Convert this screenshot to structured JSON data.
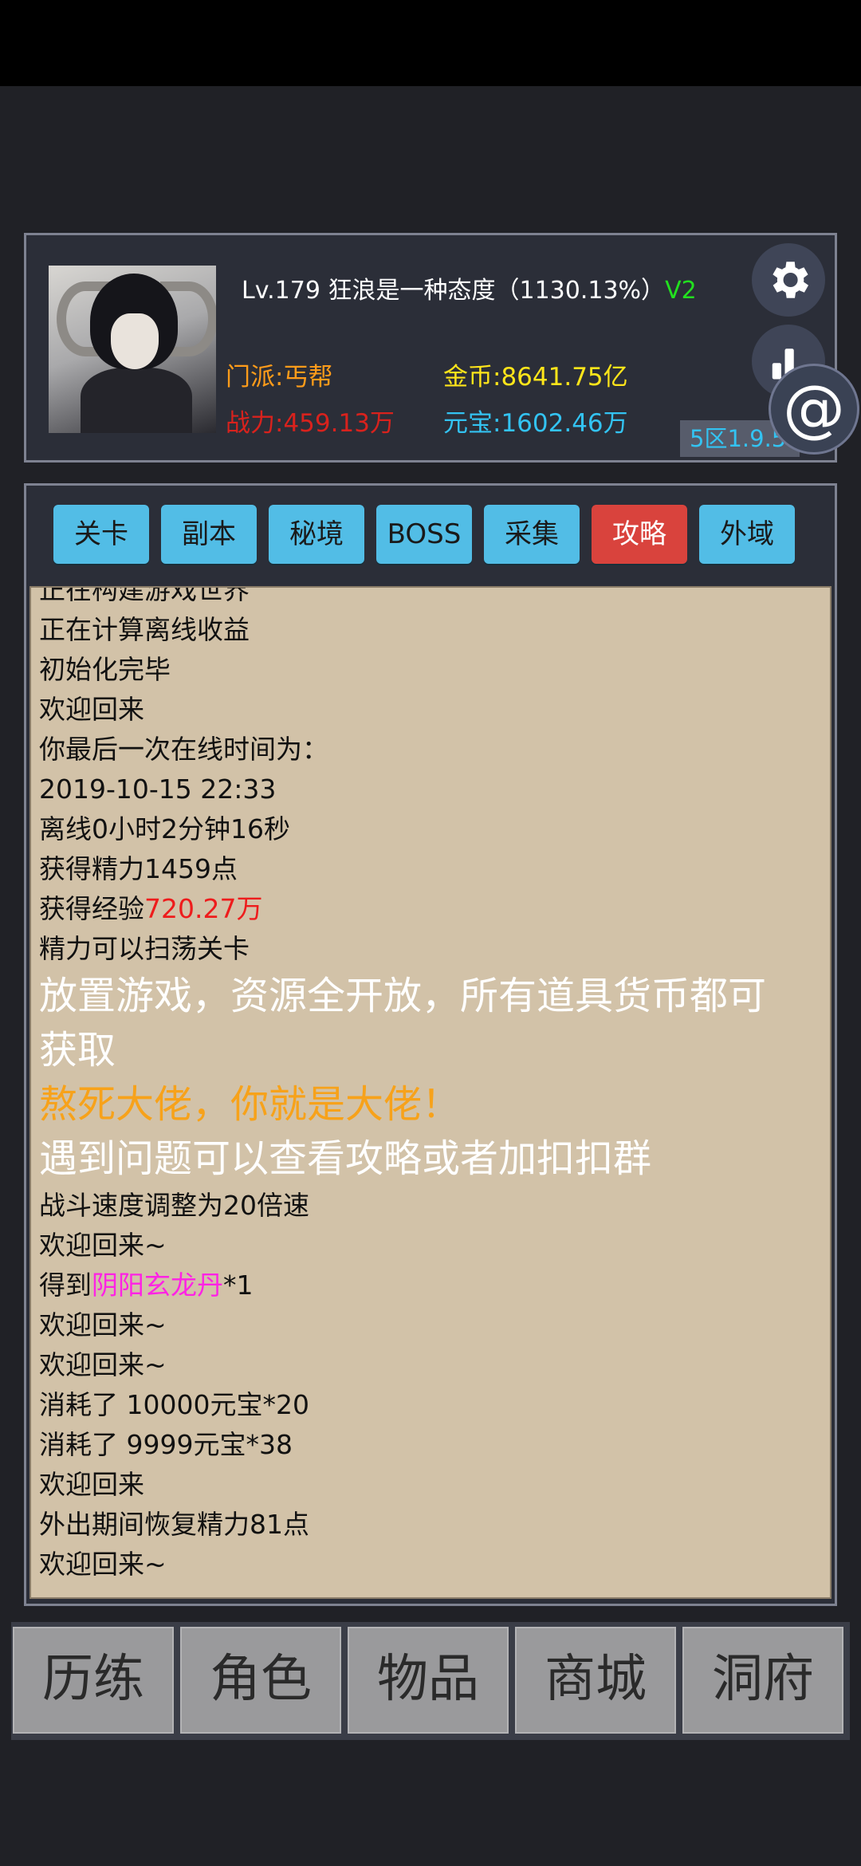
{
  "player": {
    "level": "Lv.179",
    "name": "狂浪是一种态度",
    "exp_percent": "（1130.13%）",
    "vip": "V2",
    "sect": "门派:丐帮",
    "power": "战力:459.13万",
    "gold": "金币:8641.75亿",
    "ingot": "元宝:1602.46万",
    "server": "5区1.9.5"
  },
  "icons": {
    "settings": "gear-icon",
    "ranking": "bar-chart-icon",
    "chat": "at-sign-icon"
  },
  "tabs": [
    {
      "label": "关卡",
      "active": false
    },
    {
      "label": "副本",
      "active": false
    },
    {
      "label": "秘境",
      "active": false
    },
    {
      "label": "BOSS",
      "active": false
    },
    {
      "label": "采集",
      "active": false
    },
    {
      "label": "攻略",
      "active": true
    },
    {
      "label": "外域",
      "active": false
    }
  ],
  "log": {
    "l0": "正在构建游戏世界",
    "l1": "正在计算离线收益",
    "l2": "初始化完毕",
    "l3": "欢迎回来",
    "l4": "你最后一次在线时间为：",
    "l5": "2019-10-15 22:33",
    "l6": "离线0小时2分钟16秒",
    "l7": "获得精力1459点",
    "l8_prefix": "获得经验",
    "l8_value": "720.27万",
    "l9": "精力可以扫荡关卡",
    "notice1": "放置游戏，资源全开放，所有道具货币都可",
    "notice1b": "获取",
    "notice2": "熬死大佬，你就是大佬！",
    "notice3": "遇到问题可以查看攻略或者加扣扣群",
    "l10": "战斗速度调整为20倍速",
    "l11": "欢迎回来~",
    "l12_prefix": "得到",
    "l12_item": "阴阳玄龙丹",
    "l12_suffix": "*1",
    "l13": "欢迎回来~",
    "l14": "欢迎回来~",
    "l15": "消耗了 10000元宝*20",
    "l16": "消耗了 9999元宝*38",
    "l17": "欢迎回来",
    "l18": "外出期间恢复精力81点",
    "l19": "欢迎回来~"
  },
  "bottom_nav": [
    "历练",
    "角色",
    "物品",
    "商城",
    "洞府"
  ],
  "colors": {
    "background": "#202126",
    "panel": "#2b2e38",
    "log_bg": "#d2c2a8",
    "tab": "#52bde6",
    "tab_active": "#d9433d",
    "vip": "#22e01f",
    "sect": "#ff9c1a",
    "power": "#d8221d",
    "gold": "#ffe51a",
    "ingot": "#33c3f2",
    "exp_value": "#ee1c1c",
    "item": "#ff22e5",
    "notice_orange": "#f7a21a"
  }
}
